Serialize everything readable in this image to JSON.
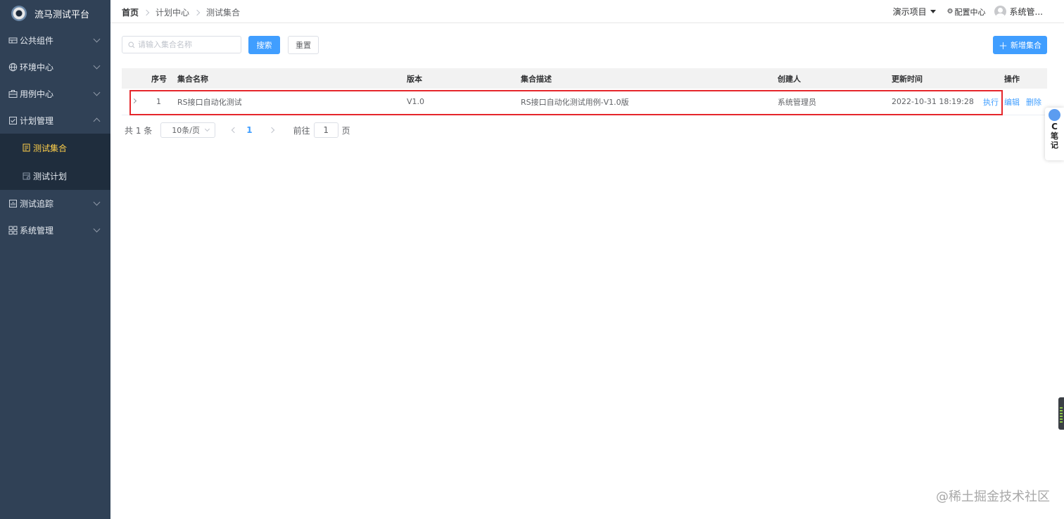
{
  "app": {
    "title": "流马测试平台"
  },
  "sidebar": {
    "items": [
      {
        "label": "公共组件",
        "icon": "table-icon"
      },
      {
        "label": "环境中心",
        "icon": "globe-icon"
      },
      {
        "label": "用例中心",
        "icon": "briefcase-icon"
      },
      {
        "label": "计划管理",
        "icon": "checklist-icon",
        "expanded": true
      },
      {
        "label": "测试追踪",
        "icon": "chart-icon"
      },
      {
        "label": "系统管理",
        "icon": "grid-icon"
      }
    ],
    "subitems": [
      {
        "label": "测试集合",
        "active": true
      },
      {
        "label": "测试计划",
        "active": false
      }
    ],
    "active_color": "#ffd04b"
  },
  "breadcrumb": [
    "首页",
    "计划中心",
    "测试集合"
  ],
  "navbar": {
    "project": "演示项目",
    "config": "配置中心",
    "user": "系统管..."
  },
  "search": {
    "placeholder": "请输入集合名称",
    "search_label": "搜索",
    "reset_label": "重置",
    "add_label": "新增集合"
  },
  "table": {
    "headers": [
      "序号",
      "集合名称",
      "版本",
      "集合描述",
      "创建人",
      "更新时间",
      "操作"
    ],
    "rows": [
      {
        "index": "1",
        "name": "RS接口自动化测试",
        "version": "V1.0",
        "description": "RS接口自动化测试用例-V1.0版",
        "creator": "系统管理员",
        "updated": "2022-10-31 18:19:28",
        "actions": [
          "执行",
          "编辑",
          "删除"
        ]
      }
    ]
  },
  "pagination": {
    "total": "共 1 条",
    "page_size": "10条/页",
    "current_page": "1",
    "goto_label": "前往",
    "goto_value": "1",
    "page_unit": "页"
  },
  "widget": {
    "c": "C",
    "line1": "笔",
    "line2": "记"
  },
  "watermark": "@稀土掘金技术社区",
  "colors": {
    "primary": "#409eff",
    "sidebar_bg": "#304156",
    "highlight": "#e5262b"
  }
}
